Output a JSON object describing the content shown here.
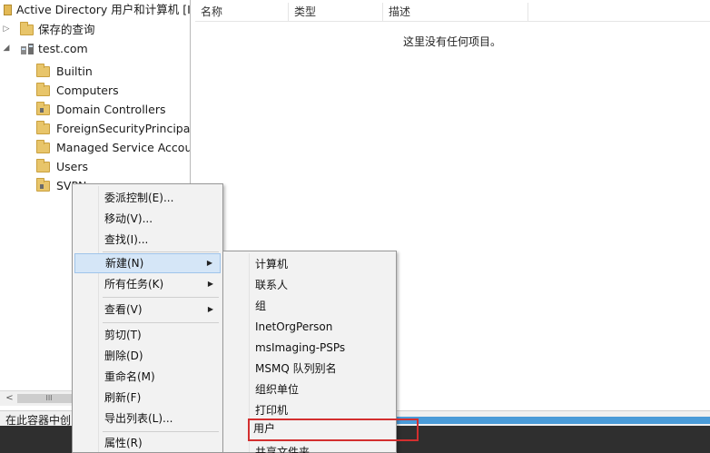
{
  "tree": {
    "title": "Active Directory 用户和计算机 [I",
    "saved_queries": "保存的查询",
    "domain": "test.com",
    "nodes": [
      {
        "label": "Builtin",
        "icon": "folder-icon"
      },
      {
        "label": "Computers",
        "icon": "folder-icon"
      },
      {
        "label": "Domain Controllers",
        "icon": "ou-folder-icon"
      },
      {
        "label": "ForeignSecurityPrincipal",
        "icon": "folder-icon"
      },
      {
        "label": "Managed Service Accou",
        "icon": "folder-icon"
      },
      {
        "label": "Users",
        "icon": "folder-icon"
      },
      {
        "label": "SVPN",
        "icon": "ou-folder-icon"
      }
    ],
    "scroll_left": "<",
    "scroll_thumb": "III"
  },
  "list": {
    "columns": [
      "名称",
      "类型",
      "描述"
    ],
    "empty_message": "这里没有任何项目。"
  },
  "status": {
    "text": "在此容器中创"
  },
  "context_menu": {
    "items": [
      {
        "label": "委派控制(E)..."
      },
      {
        "label": "移动(V)..."
      },
      {
        "label": "查找(I)..."
      },
      {
        "label": "新建(N)",
        "arrow": "▶"
      },
      {
        "label": "所有任务(K)",
        "arrow": "▶"
      },
      {
        "label": "查看(V)",
        "arrow": "▶"
      },
      {
        "label": "剪切(T)"
      },
      {
        "label": "删除(D)"
      },
      {
        "label": "重命名(M)"
      },
      {
        "label": "刷新(F)"
      },
      {
        "label": "导出列表(L)..."
      },
      {
        "label": "属性(R)"
      }
    ]
  },
  "new_submenu": {
    "items": [
      {
        "label": "计算机"
      },
      {
        "label": "联系人"
      },
      {
        "label": "组"
      },
      {
        "label": "InetOrgPerson"
      },
      {
        "label": "msImaging-PSPs"
      },
      {
        "label": "MSMQ 队列别名"
      },
      {
        "label": "组织单位"
      },
      {
        "label": "打印机"
      },
      {
        "label": "用户"
      },
      {
        "label": "共享文件夹"
      }
    ]
  },
  "colors": {
    "highlight": "#d5e6f7",
    "red_box": "#d32f2f",
    "status_accent": "#4a9bd8"
  }
}
